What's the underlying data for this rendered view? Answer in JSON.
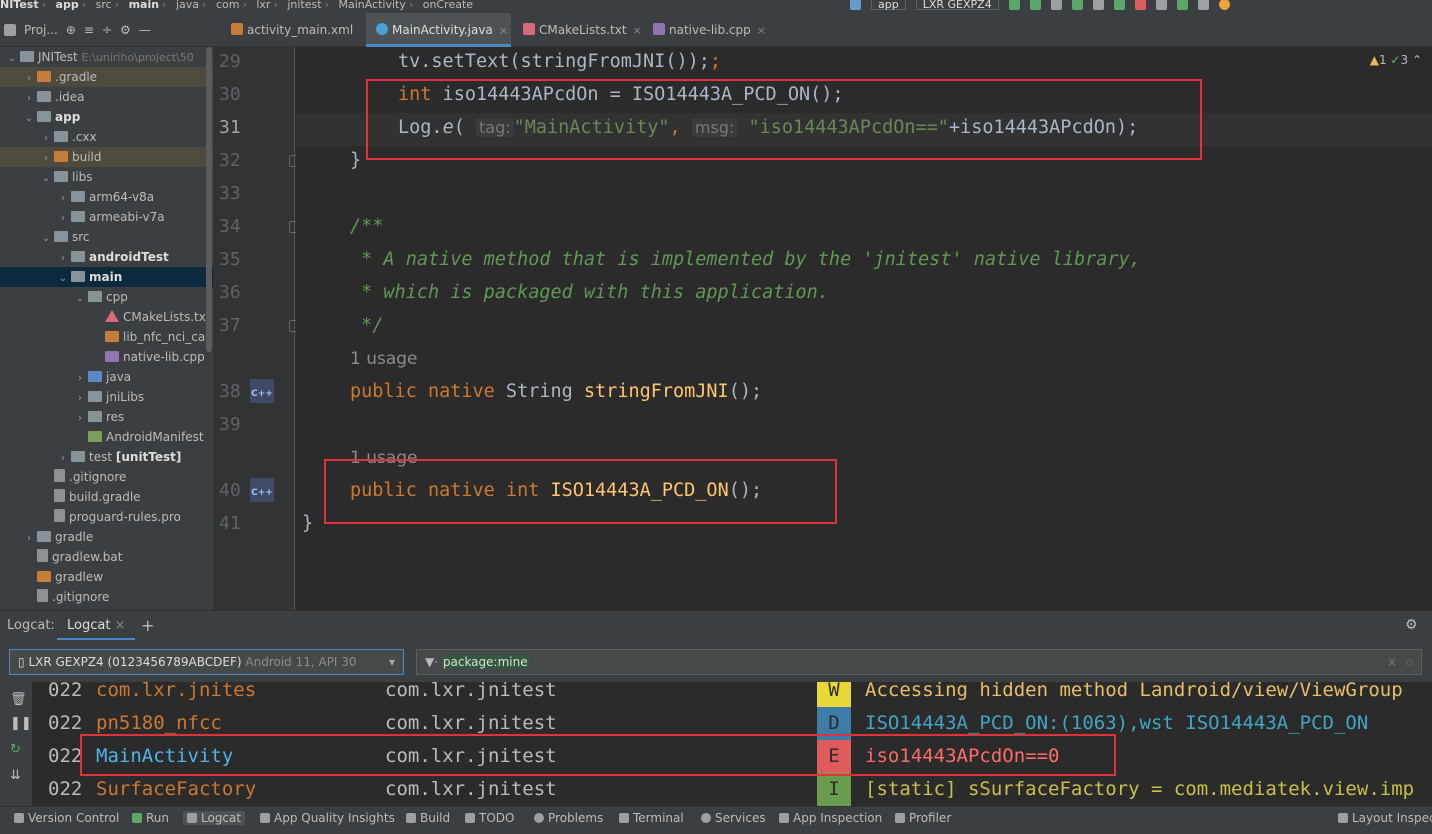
{
  "breadcrumbs": [
    "NITest",
    "app",
    "src",
    "main",
    "java",
    "com",
    "lxr",
    "jnitest",
    "MainActivity",
    "onCreate"
  ],
  "toolbar": {
    "config": "app",
    "device": "LXR GEXPZ4"
  },
  "project_panel": {
    "title": "Proj..."
  },
  "tree": [
    {
      "label": "JNITest",
      "extra": "E:\\uniriho\\project\\50",
      "icon": "folder",
      "indent": 0,
      "arrow": "v"
    },
    {
      "label": ".gradle",
      "icon": "folder-orange",
      "indent": 1,
      "arrow": ">",
      "highlight": true
    },
    {
      "label": ".idea",
      "icon": "folder",
      "indent": 1,
      "arrow": ">"
    },
    {
      "label": "app",
      "icon": "folder",
      "indent": 1,
      "arrow": "v",
      "bold": true
    },
    {
      "label": ".cxx",
      "icon": "folder",
      "indent": 2,
      "arrow": ">"
    },
    {
      "label": "build",
      "icon": "folder-orange",
      "indent": 2,
      "arrow": ">",
      "highlight": true
    },
    {
      "label": "libs",
      "icon": "folder",
      "indent": 2,
      "arrow": "v"
    },
    {
      "label": "arm64-v8a",
      "icon": "folder",
      "indent": 3,
      "arrow": ">"
    },
    {
      "label": "armeabi-v7a",
      "icon": "folder",
      "indent": 3,
      "arrow": ">"
    },
    {
      "label": "src",
      "icon": "folder",
      "indent": 2,
      "arrow": "v"
    },
    {
      "label": "androidTest",
      "icon": "folder",
      "indent": 3,
      "arrow": ">",
      "bold": true
    },
    {
      "label": "main",
      "icon": "folder",
      "indent": 3,
      "arrow": "v",
      "bold": true,
      "selected": true
    },
    {
      "label": "cpp",
      "icon": "folder",
      "indent": 4,
      "arrow": "v"
    },
    {
      "label": "CMakeLists.tx",
      "icon": "cmake",
      "indent": 5,
      "arrow": ""
    },
    {
      "label": "lib_nfc_nci_ca",
      "icon": "lib",
      "indent": 5,
      "arrow": ""
    },
    {
      "label": "native-lib.cpp",
      "icon": "cpp",
      "indent": 5,
      "arrow": ""
    },
    {
      "label": "java",
      "icon": "folder-blue",
      "indent": 4,
      "arrow": ">"
    },
    {
      "label": "jniLibs",
      "icon": "folder",
      "indent": 4,
      "arrow": ">"
    },
    {
      "label": "res",
      "icon": "folder",
      "indent": 4,
      "arrow": ">"
    },
    {
      "label": "AndroidManifest",
      "icon": "manifest",
      "indent": 4,
      "arrow": ""
    },
    {
      "label": "test",
      "bold_suffix": "[unitTest]",
      "icon": "folder",
      "indent": 3,
      "arrow": ">"
    },
    {
      "label": ".gitignore",
      "icon": "file",
      "indent": 2,
      "arrow": ""
    },
    {
      "label": "build.gradle",
      "icon": "gradle",
      "indent": 2,
      "arrow": ""
    },
    {
      "label": "proguard-rules.pro",
      "icon": "file",
      "indent": 2,
      "arrow": ""
    },
    {
      "label": "gradle",
      "icon": "folder",
      "indent": 1,
      "arrow": ">"
    },
    {
      "label": "gradlew.bat",
      "icon": "file",
      "indent": 1,
      "arrow": ""
    },
    {
      "label": "gradlew",
      "icon": "lib",
      "indent": 1,
      "arrow": ""
    },
    {
      "label": ".gitignore",
      "icon": "file",
      "indent": 1,
      "arrow": ""
    }
  ],
  "tabs": [
    {
      "label": "activity_main.xml",
      "color": "#c77d3a",
      "active": false
    },
    {
      "label": "MainActivity.java",
      "color": "#4a9fd6",
      "active": true
    },
    {
      "label": "CMakeLists.txt",
      "color": "#d46a7c",
      "active": false
    },
    {
      "label": "native-lib.cpp",
      "color": "#8f73b3",
      "active": false
    }
  ],
  "inspections": {
    "warnings": "1",
    "weak": "3"
  },
  "code": {
    "line_numbers": [
      "29",
      "30",
      "31",
      "32",
      "33",
      "34",
      "35",
      "36",
      "37",
      "",
      "38",
      "39",
      "",
      "40",
      "41"
    ],
    "current_line": "31",
    "l29_a": "tv.setText(",
    "l29_b": "stringFromJNI",
    "l29_c": "());",
    "l30_kw": "int",
    "l30_a": " iso14443APcdOn = ",
    "l30_fn": "ISO14443A_PCD_ON",
    "l30_b": "();",
    "l31_a": "Log.",
    "l31_e": "e",
    "l31_b": "( ",
    "l31_tag": "tag:",
    "l31_s1": "\"MainActivity\"",
    "l31_comma": ", ",
    "l31_msg": "msg:",
    "l31_s2": "\"iso14443APcdOn==\"",
    "l31_c": "+iso14443APcdOn);",
    "l32": "}",
    "l34": "/**",
    "l35": " * A native method that is implemented by the 'jnitest' native library,",
    "l36": " * which is packaged with this application.",
    "l37": " */",
    "usage1": "1 usage",
    "l38_k": "public native",
    "l38_a": " String ",
    "l38_fn": "stringFromJNI",
    "l38_b": "();",
    "usage2": "1 usage",
    "l40_k": "public native int",
    "l40_fn": " ISO14443A_PCD_ON",
    "l40_b": "();",
    "l41": "}"
  },
  "logcat": {
    "label": "Logcat:",
    "tab": "Logcat",
    "device": "LXR GEXPZ4 (0123456789ABCDEF)",
    "device_detail": " Android 11, API 30",
    "filter": "package:mine",
    "rows": [
      {
        "date": "022",
        "tag": "com.lxr.jnites",
        "tag_color": "#cc7832",
        "pkg": "com.lxr.jnitest",
        "level": "W",
        "level_bg": "#e8d836",
        "msg": "Accessing hidden method Landroid/view/ViewGroup",
        "msg_color": "#e8bf6a"
      },
      {
        "date": "022",
        "tag": "pn5180_nfcc",
        "tag_color": "#cc7832",
        "pkg": "com.lxr.jnitest",
        "level": "D",
        "level_bg": "#3d7ca8",
        "msg": "ISO14443A_PCD_ON:(1063),wst ISO14443A_PCD_ON",
        "msg_color": "#3fa7c4"
      },
      {
        "date": "022",
        "tag": "MainActivity",
        "tag_color": "#4fb4e8",
        "pkg": "com.lxr.jnitest",
        "level": "E",
        "level_bg": "#e05c5c",
        "msg": "iso14443APcdOn==0",
        "msg_color": "#ff6b68"
      },
      {
        "date": "022",
        "tag": "SurfaceFactory",
        "tag_color": "#cc7832",
        "pkg": "com.lxr.jnitest",
        "level": "I",
        "level_bg": "#6a9e4e",
        "msg": "[static] sSurfaceFactory = com.mediatek.view.imp",
        "msg_color": "#c8c04a"
      }
    ]
  },
  "statusbar": {
    "items": [
      "Version Control",
      "Run",
      "Logcat",
      "App Quality Insights",
      "Build",
      "TODO",
      "Problems",
      "Terminal",
      "Services",
      "App Inspection",
      "Profiler",
      "Layout Inspector"
    ]
  }
}
